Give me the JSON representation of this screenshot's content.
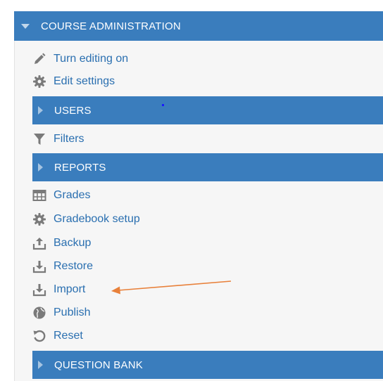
{
  "course_admin": {
    "title": "COURSE ADMINISTRATION",
    "items": [
      {
        "label": "Turn editing on",
        "icon": "pencil-icon"
      },
      {
        "label": "Edit settings",
        "icon": "gear-icon"
      }
    ]
  },
  "users": {
    "title": "USERS",
    "items": [
      {
        "label": "Filters",
        "icon": "filter-icon"
      }
    ]
  },
  "reports": {
    "title": "REPORTS",
    "items": [
      {
        "label": "Grades",
        "icon": "table-icon"
      },
      {
        "label": "Gradebook setup",
        "icon": "gear-icon"
      },
      {
        "label": "Backup",
        "icon": "upload-icon"
      },
      {
        "label": "Restore",
        "icon": "download-icon"
      },
      {
        "label": "Import",
        "icon": "download-icon"
      },
      {
        "label": "Publish",
        "icon": "globe-icon"
      },
      {
        "label": "Reset",
        "icon": "reset-icon"
      }
    ]
  },
  "question_bank": {
    "title": "QUESTION BANK"
  },
  "colors": {
    "header_bg": "#3a7dbd",
    "link": "#2a6fb0",
    "icon": "#7a7a7a",
    "annotation_arrow": "#e8803a"
  }
}
